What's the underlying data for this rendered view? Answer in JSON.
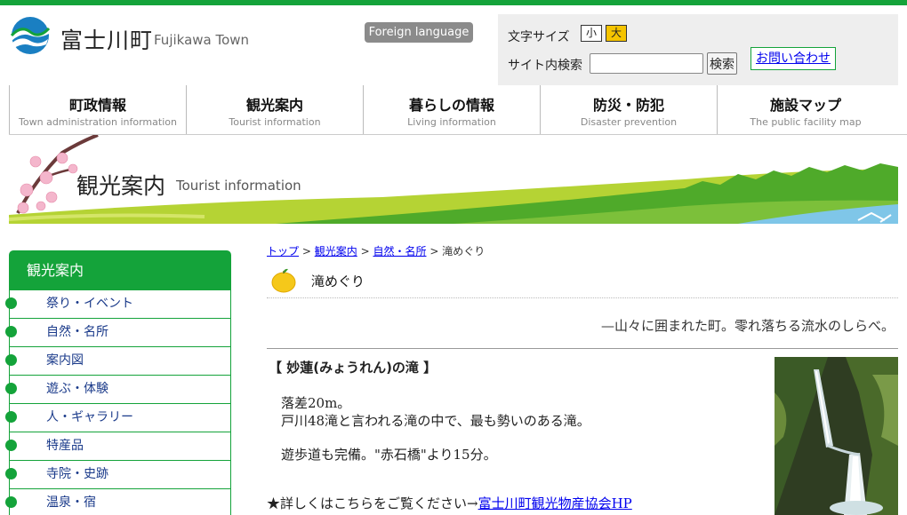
{
  "header": {
    "title": "富士川町",
    "title_en": "Fujikawa Town",
    "foreign_language": "Foreign language",
    "font_size_label": "文字サイズ",
    "font_small": "小",
    "font_large": "大",
    "search_label": "サイト内検索",
    "search_button": "検索",
    "contact": "お問い合わせ"
  },
  "nav": [
    {
      "jp": "町政情報",
      "en": "Town administration information"
    },
    {
      "jp": "観光案内",
      "en": "Tourist information"
    },
    {
      "jp": "暮らしの情報",
      "en": "Living information"
    },
    {
      "jp": "防災・防犯",
      "en": "Disaster prevention"
    },
    {
      "jp": "施設マップ",
      "en": "The public facility map"
    }
  ],
  "banner": {
    "title": "観光案内",
    "title_en": "Tourist information"
  },
  "sidebar": {
    "heading": "観光案内",
    "items": [
      "祭り・イベント",
      "自然・名所",
      "案内図",
      "遊ぶ・体験",
      "人・ギャラリー",
      "特産品",
      "寺院・史跡",
      "温泉・宿"
    ]
  },
  "breadcrumb": {
    "top": "トップ",
    "sep": ">",
    "l1": "観光案内",
    "l2": "自然・名所",
    "current": "滝めぐり"
  },
  "page": {
    "title": "滝めぐり",
    "tagline": "—山々に囲まれた町。零れ落ちる流水のしらべ。",
    "falls_name": "【 妙蓮(みょうれん)の滝 】",
    "drop": "落差20m。",
    "desc1": "戸川48滝と言われる滝の中で、最も勢いのある滝。",
    "desc2": "遊歩道も完備。\"赤石橋\"より15分。",
    "more_prefix": "★詳しくはこちらをご覧ください→",
    "more_link": "富士川町観光物産協会HP"
  },
  "colors": {
    "brand_green": "#14a33a",
    "accent_yellow": "#f5c400",
    "link": "#0000ee"
  }
}
